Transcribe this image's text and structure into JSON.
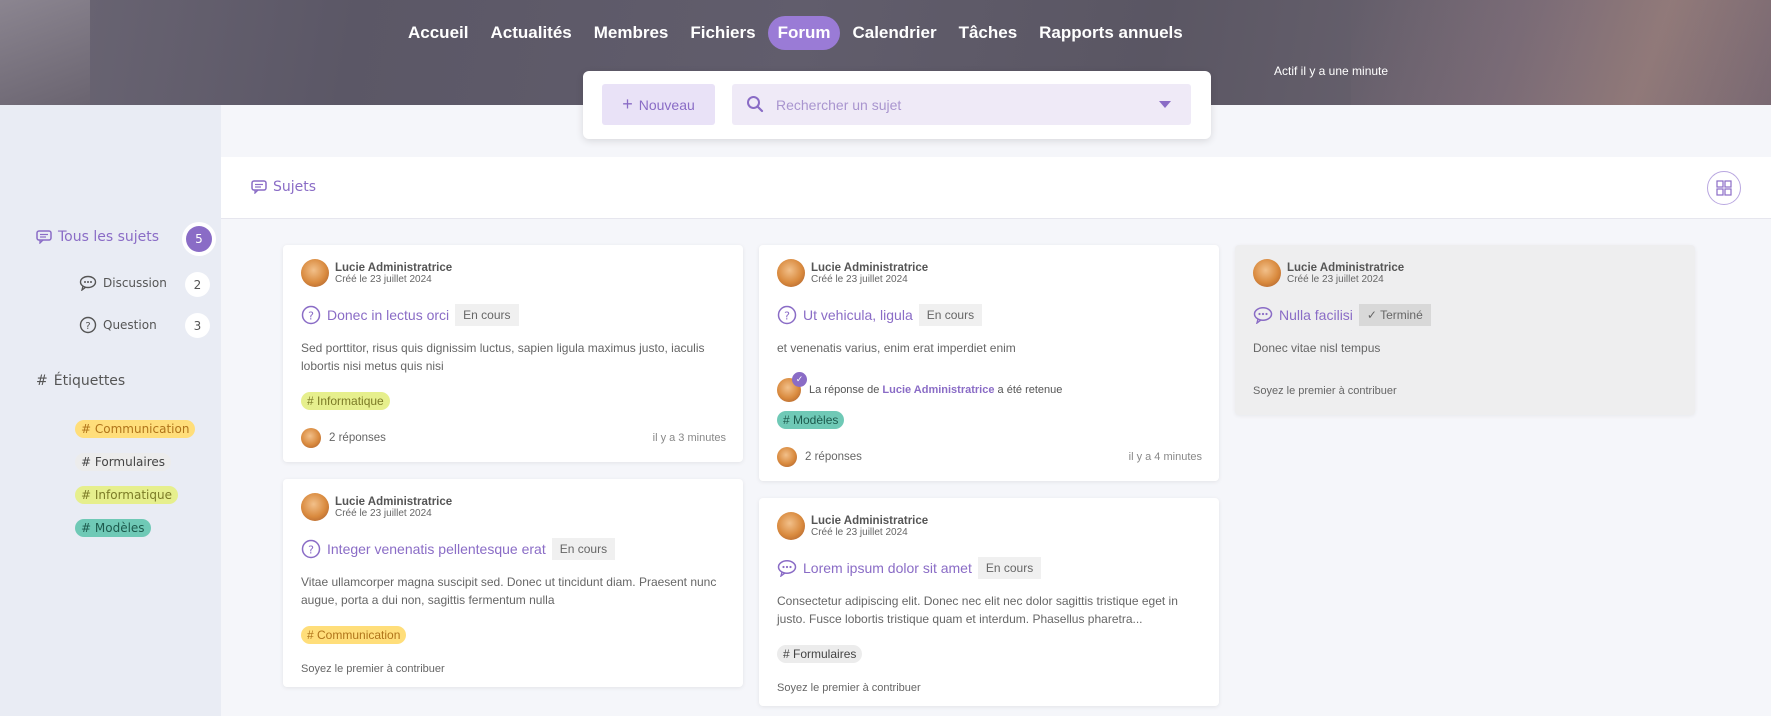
{
  "nav": {
    "items": [
      "Accueil",
      "Actualités",
      "Membres",
      "Fichiers",
      "Forum",
      "Calendrier",
      "Tâches",
      "Rapports annuels"
    ],
    "active": "Forum",
    "activity_status": "Actif il y a une minute"
  },
  "search": {
    "new_label": "Nouveau",
    "placeholder": "Rechercher un sujet"
  },
  "sidebar": {
    "all_label": "Tous les sujets",
    "all_count": "5",
    "categories": [
      {
        "label": "Discussion",
        "count": "2",
        "icon": "chat-bubble-icon"
      },
      {
        "label": "Question",
        "count": "3",
        "icon": "question-circle-icon"
      }
    ],
    "tags_title": "Étiquettes",
    "tags": [
      {
        "label": "Communication",
        "color": "#ffde7a"
      },
      {
        "label": "Formulaires",
        "color": "#ececec"
      },
      {
        "label": "Informatique",
        "color": "#e6ef8d"
      },
      {
        "label": "Modèles",
        "color": "#6fc9b6"
      }
    ]
  },
  "main": {
    "title": "Sujets"
  },
  "cards": [
    {
      "author": "Lucie Administratrice",
      "date": "Créé le 23 juillet 2024",
      "title": "Donec in lectus orci",
      "status": "En cours",
      "excerpt": "Sed porttitor, risus quis dignissim luctus, sapien ligula maximus justo, iaculis lobortis nisi metus quis nisi",
      "tag": "Informatique",
      "replies": "2 réponses",
      "time": "il y a 3 minutes"
    },
    {
      "author": "Lucie Administratrice",
      "date": "Créé le 23 juillet 2024",
      "title": "Integer venenatis pellentesque erat",
      "status": "En cours",
      "excerpt": "Vitae ullamcorper magna suscipit sed. Donec ut tincidunt diam. Praesent nunc augue, porta a dui non, sagittis fermentum nulla",
      "tag": "Communication",
      "contrib": "Soyez le premier à contribuer"
    },
    {
      "author": "Lucie Administratrice",
      "date": "Créé le 23 juillet 2024",
      "title": "Ut vehicula, ligula",
      "status": "En cours",
      "excerpt": "et venenatis varius, enim erat imperdiet enim",
      "answer_prefix": "La réponse de",
      "answer_author": "Lucie Administratrice",
      "answer_suffix": "a été retenue",
      "tag": "Modèles",
      "replies": "2 réponses",
      "time": "il y a 4 minutes"
    },
    {
      "author": "Lucie Administratrice",
      "date": "Créé le 23 juillet 2024",
      "title": "Lorem ipsum dolor sit amet",
      "status": "En cours",
      "excerpt": "Consectetur adipiscing elit. Donec nec elit nec dolor sagittis tristique eget in justo. Fusce lobortis tristique quam et interdum. Phasellus pharetra...",
      "tag": "Formulaires",
      "contrib": "Soyez le premier à contribuer"
    },
    {
      "author": "Lucie Administratrice",
      "date": "Créé le 23 juillet 2024",
      "title": "Nulla facilisi",
      "status": "Terminé",
      "excerpt": "Donec vitae nisl tempus",
      "contrib": "Soyez le premier à contribuer"
    }
  ]
}
